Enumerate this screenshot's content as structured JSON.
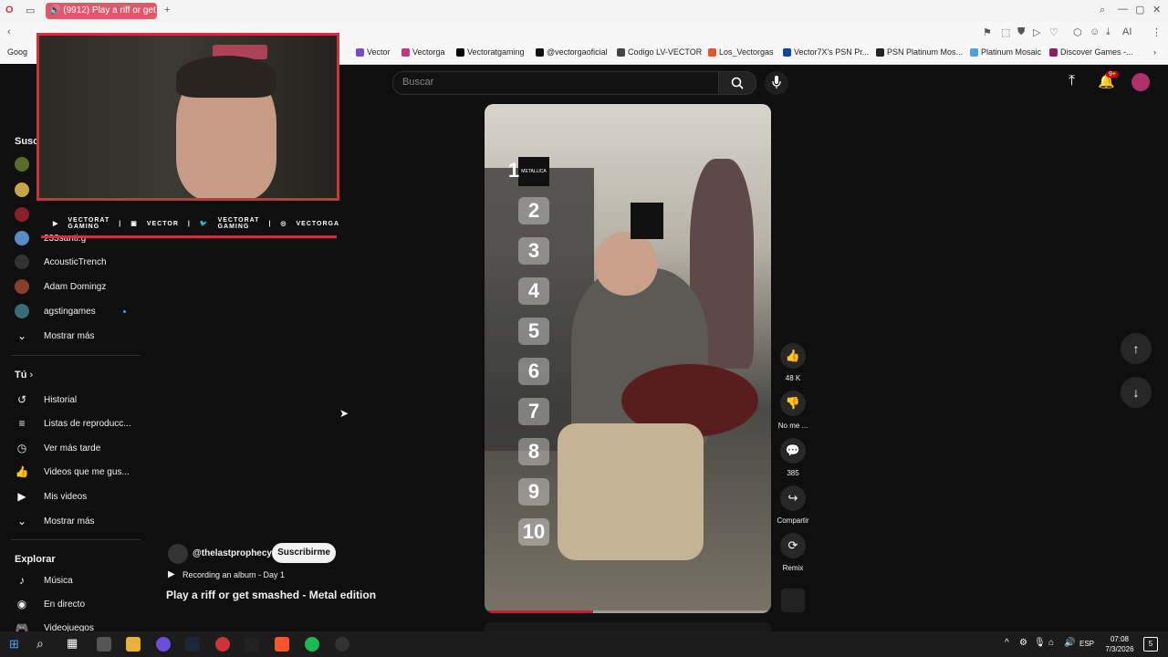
{
  "browser": {
    "tab_title": "(9912) Play a riff or get",
    "bookmarks": [
      "Goog",
      "Vector",
      "Vectorga",
      "Vectoratgaming",
      "@vectorgaoficial",
      "Codigo LV-VECTOR",
      "Los_Vectorgas",
      "Vector7X's PSN Pr...",
      "PSN Platinum Mos...",
      "Platinum Mosaic",
      "Discover Games -..."
    ]
  },
  "overlay": {
    "socials": [
      "VECTORAT GAMING",
      "VECTOR",
      "VECTORAT GAMING",
      "VECTORGA"
    ]
  },
  "search": {
    "placeholder": "Buscar"
  },
  "notifications": {
    "badge": "9+"
  },
  "sidebar": {
    "subs_heading": "Susc",
    "channels": [
      {
        "name": "233santi.g",
        "color": "#5a8dc7"
      },
      {
        "name": "AcousticTrench",
        "color": "#333"
      },
      {
        "name": "Adam Domingz",
        "color": "#8a3d2b"
      },
      {
        "name": "agstingames",
        "color": "#3a6b7a"
      }
    ],
    "more_label_1": "Mostrar más",
    "you_heading": "Tú",
    "you_items": [
      "Historial",
      "Listas de reproducc...",
      "Ver más tarde",
      "Videos que me gus...",
      "Mis videos"
    ],
    "more_label_2": "Mostrar más",
    "explore_heading": "Explorar",
    "explore_items": [
      "Música",
      "En directo",
      "Videojuegos"
    ]
  },
  "short": {
    "channel": "@thelastprophecyfi",
    "subscribe_label": "Suscribirme",
    "playlist": "Recording an album - Day 1",
    "title": "Play a riff or get smashed - Metal edition",
    "numbers": [
      "1",
      "2",
      "3",
      "4",
      "5",
      "6",
      "7",
      "8",
      "9",
      "10"
    ],
    "progress_fraction": 0.38
  },
  "rail": {
    "likes": "48 K",
    "dislike_label": "No me ...",
    "comments": "385",
    "share_label": "Compartir",
    "remix_label": "Remix"
  },
  "taskbar": {
    "lang": "ESP",
    "time": "07:08",
    "date": "7/3/2026",
    "notif_count": "5"
  }
}
